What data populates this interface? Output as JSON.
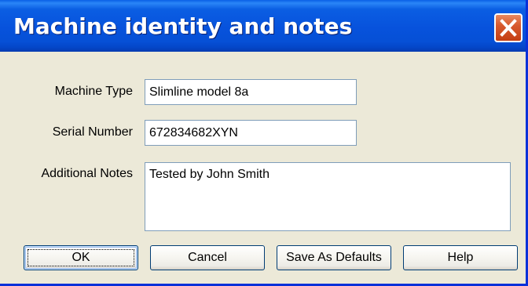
{
  "window": {
    "title": "Machine identity and notes"
  },
  "form": {
    "machine_type": {
      "label": "Machine Type",
      "value": "Slimline model 8a"
    },
    "serial_number": {
      "label": "Serial Number",
      "value": "672834682XYN"
    },
    "additional_notes": {
      "label": "Additional Notes",
      "value": "Tested by John Smith"
    }
  },
  "buttons": {
    "ok": "OK",
    "cancel": "Cancel",
    "save_defaults": "Save As Defaults",
    "help": "Help"
  },
  "icons": {
    "close": "close-icon"
  },
  "colors": {
    "titlebar": "#0752dc",
    "close_button": "#d85a2e",
    "dialog_background": "#ece9d8",
    "input_border": "#7f9db9"
  }
}
